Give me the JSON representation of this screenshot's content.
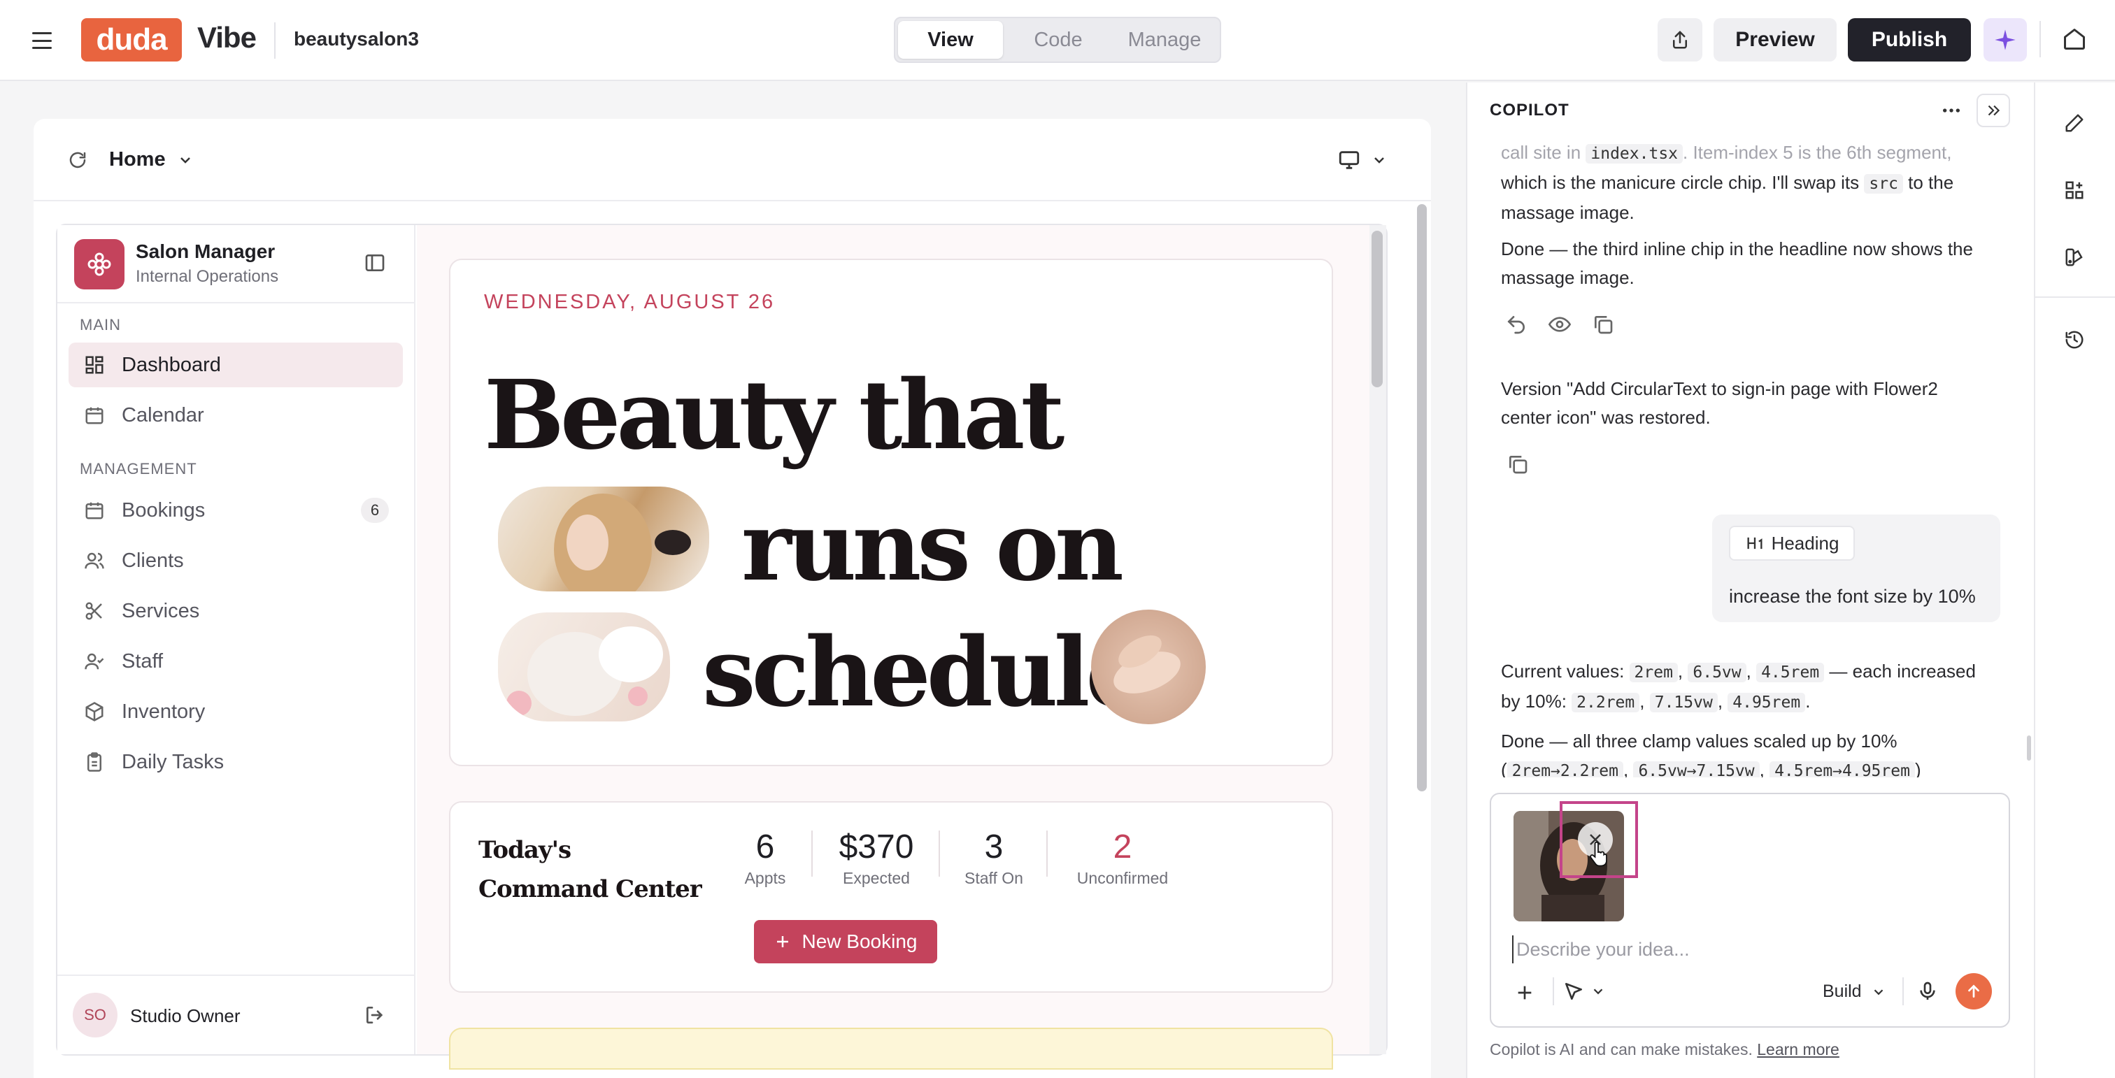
{
  "topbar": {
    "logo_text": "duda",
    "product": "Vibe",
    "site_name": "beautysalon3",
    "modes": [
      "View",
      "Code",
      "Manage"
    ],
    "active_mode": "View",
    "preview_label": "Preview",
    "publish_label": "Publish"
  },
  "canvas": {
    "page_name": "Home"
  },
  "app": {
    "title": "Salon Manager",
    "subtitle": "Internal Operations",
    "section_main": "MAIN",
    "section_management": "MANAGEMENT",
    "nav": {
      "dashboard": "Dashboard",
      "calendar": "Calendar",
      "bookings": "Bookings",
      "bookings_badge": "6",
      "clients": "Clients",
      "services": "Services",
      "staff": "Staff",
      "inventory": "Inventory",
      "daily_tasks": "Daily Tasks"
    },
    "owner_initials": "SO",
    "owner_name": "Studio Owner",
    "hero": {
      "date": "WEDNESDAY, AUGUST 26",
      "line1": "Beauty that",
      "line2": "runs on",
      "line3": "schedule"
    },
    "command": {
      "title": "Today's Command Center",
      "stats": [
        {
          "value": "6",
          "label": "Appts"
        },
        {
          "value": "$370",
          "label": "Expected"
        },
        {
          "value": "3",
          "label": "Staff On"
        },
        {
          "value": "2",
          "label": "Unconfirmed"
        }
      ],
      "new_booking": "New Booking"
    }
  },
  "copilot": {
    "title": "COPILOT",
    "msg1_a": "call site in ",
    "msg1_code": "index.tsx",
    "msg1_b": ". Item-index 5 is the 6th segment,",
    "msg1_c": "which is the manicure circle chip. I'll swap its ",
    "msg1_code2": "src",
    "msg1_d": " to the",
    "msg1_e": "massage image.",
    "msg2": "Done — the third inline chip in the headline now shows the massage image.",
    "msg3": "Version \"Add CircularText to sign-in page with Flower2 center icon\" was restored.",
    "user_chip": "Heading",
    "user_msg": "increase the font size by 10%",
    "msg4_a": "Current values: ",
    "msg4_v1": "2rem",
    "msg4_v2": "6.5vw",
    "msg4_v3": "4.5rem",
    "msg4_b": " — each increased",
    "msg4_c": "by 10%: ",
    "msg4_n1": "2.2rem",
    "msg4_n2": "7.15vw",
    "msg4_n3": "4.95rem",
    "msg5_a": "Done — all three clamp values scaled up by 10%",
    "msg5_c1": "2rem→2.2rem",
    "msg5_c2": "6.5vw→7.15vw",
    "msg5_c3": "4.5rem→4.95rem",
    "input_placeholder": "Describe your idea...",
    "build_label": "Build",
    "disclaimer": "Copilot is AI and can make mistakes.",
    "learn_more": "Learn more"
  },
  "colors": {
    "brand_orange": "#e8643f",
    "salon_rose": "#c4435c",
    "ai_purple": "#7b4fe0"
  }
}
